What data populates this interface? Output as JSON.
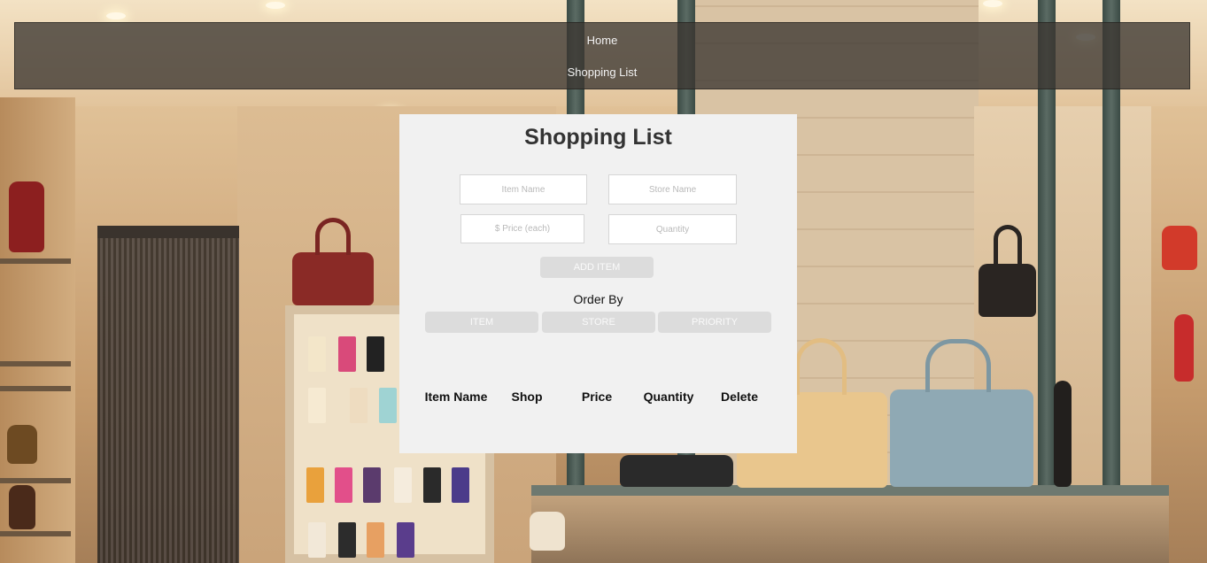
{
  "nav": {
    "home_label": "Home",
    "shopping_list_label": "Shopping List"
  },
  "panel": {
    "title": "Shopping List",
    "inputs": {
      "item_name_placeholder": "Item Name",
      "store_name_placeholder": "Store Name",
      "price_placeholder": "$ Price (each)",
      "quantity_placeholder": "Quantity"
    },
    "add_button_label": "ADD ITEM",
    "order_by_label": "Order By",
    "order_buttons": {
      "item": "ITEM",
      "store": "STORE",
      "priority": "PRIORITY"
    },
    "table_headers": [
      "Item Name",
      "Shop",
      "Price",
      "Quantity",
      "Delete"
    ]
  },
  "colors": {
    "nav_background": "#3c3732",
    "panel_background": "#f1f1f1",
    "button_background": "#dcdcdc"
  }
}
